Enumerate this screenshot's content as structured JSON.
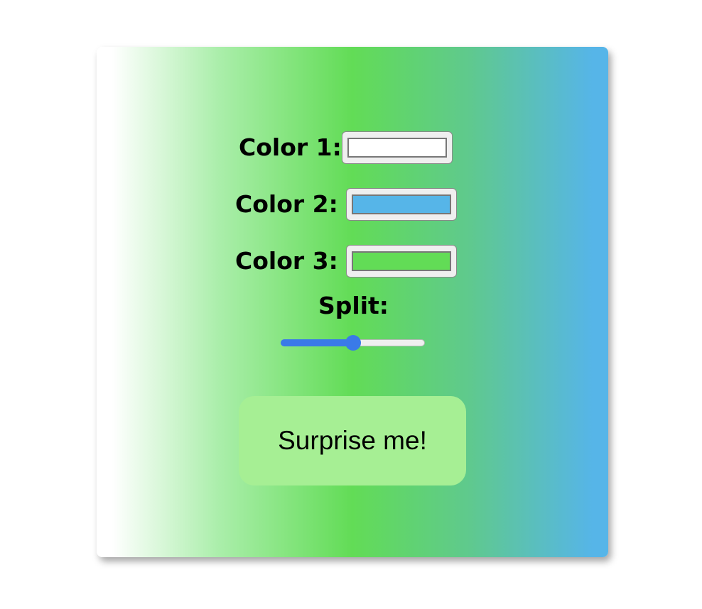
{
  "form": {
    "color1": {
      "label": "Color 1:",
      "value": "#ffffff"
    },
    "color2": {
      "label": "Color 2:",
      "value": "#56b5e8"
    },
    "color3": {
      "label": "Color 3:",
      "value": "#62dc56"
    },
    "split": {
      "label": "Split:",
      "value": 50,
      "min": 0,
      "max": 100
    },
    "surprise_button": {
      "label": "Surprise me!"
    }
  },
  "colors": {
    "slider_accent": "#3a7ae8",
    "button_bg": "#a6ef94"
  }
}
